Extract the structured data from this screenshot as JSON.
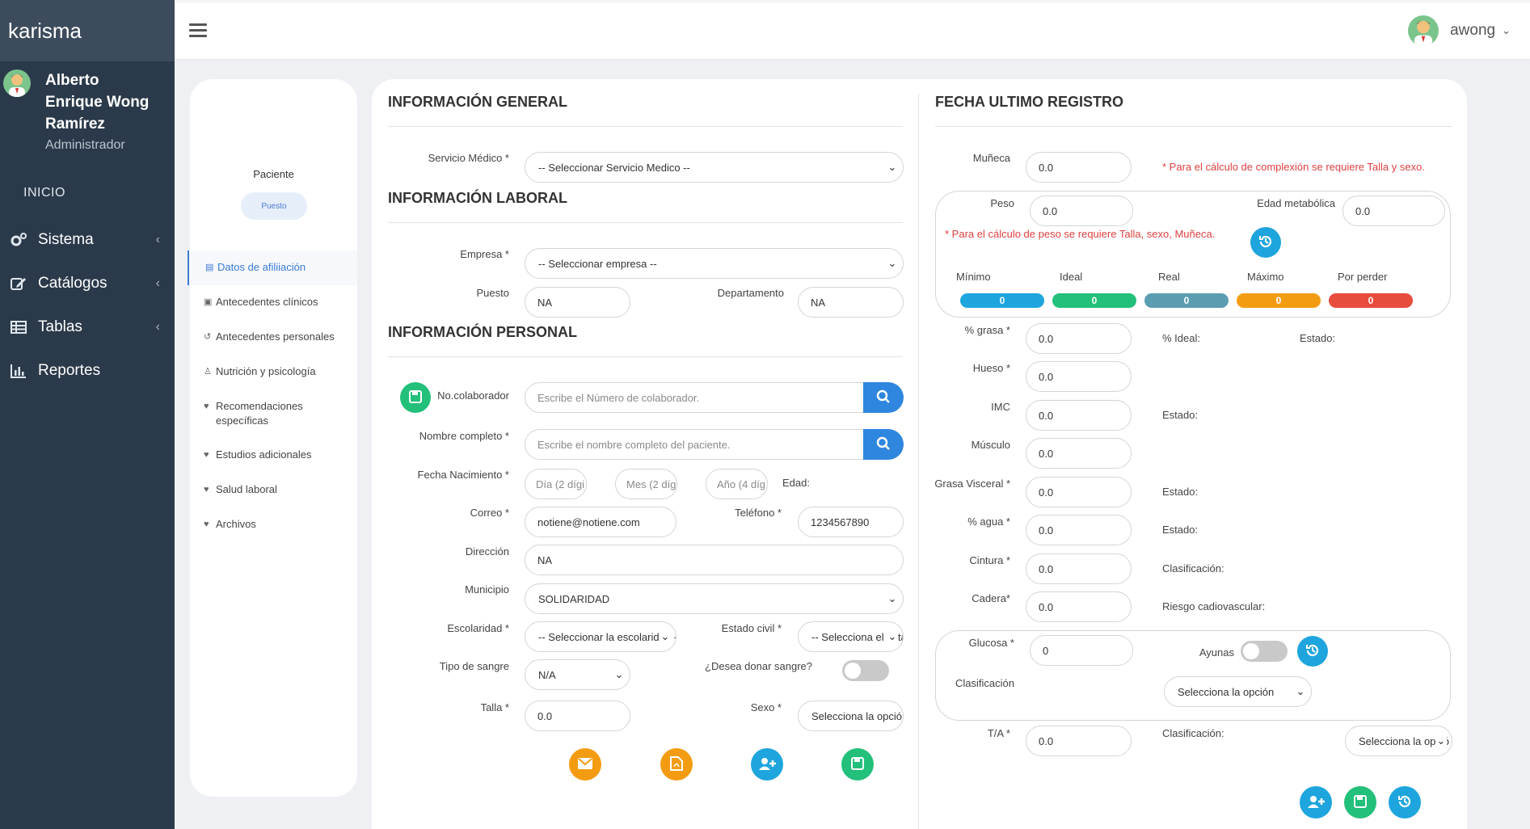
{
  "app": {
    "brand": "karisma"
  },
  "user": {
    "name": "Alberto Enrique Wong Ramírez",
    "role": "Administrador",
    "username": "awong"
  },
  "sidebar": {
    "section_label": "INICIO",
    "items": [
      {
        "label": "Sistema",
        "icon": "cogs-icon"
      },
      {
        "label": "Catálogos",
        "icon": "edit-icon"
      },
      {
        "label": "Tablas",
        "icon": "table-icon"
      },
      {
        "label": "Reportes",
        "icon": "bar-chart-icon"
      }
    ]
  },
  "patient_card": {
    "title": "Paciente",
    "badge": "Puesto",
    "menu": [
      {
        "label": "Datos de afiliiación",
        "icon": "id-card-icon",
        "active": true
      },
      {
        "label": "Antecedentes clínicos",
        "icon": "medkit-icon"
      },
      {
        "label": "Antecedentes personales",
        "icon": "history-icon"
      },
      {
        "label": "Nutrición y psicología",
        "icon": "user-doctor-icon"
      },
      {
        "label": "Recomendaciones específicas",
        "icon": "heartbeat-icon"
      },
      {
        "label": "Estudios adicionales",
        "icon": "heartbeat-icon"
      },
      {
        "label": "Salud laboral",
        "icon": "heartbeat-icon"
      },
      {
        "label": "Archivos",
        "icon": "heartbeat-icon"
      }
    ]
  },
  "general": {
    "title": "INFORMACIÓN GENERAL",
    "servicio_label": "Servicio Médico *",
    "servicio_value": "-- Seleccionar Servicio Medico --"
  },
  "laboral": {
    "title": "INFORMACIÓN LABORAL",
    "empresa_label": "Empresa *",
    "empresa_value": "-- Seleccionar empresa --",
    "puesto_label": "Puesto",
    "puesto_value": "NA",
    "departamento_label": "Departamento",
    "departamento_value": "NA"
  },
  "personal": {
    "title": "INFORMACIÓN PERSONAL",
    "colaborador_label": "No.colaborador",
    "colaborador_placeholder": "Escribe el Número de colaborador.",
    "nombre_label": "Nombre completo *",
    "nombre_placeholder": "Escribe el nombre completo del paciente.",
    "fecha_label": "Fecha Nacimiento *",
    "dia_placeholder": "Día (2 dígi",
    "mes_placeholder": "Mes (2 díg",
    "anio_placeholder": "Año (4 díg",
    "edad_label": "Edad:",
    "correo_label": "Correo *",
    "correo_value": "notiene@notiene.com",
    "telefono_label": "Teléfono *",
    "telefono_value": "1234567890",
    "direccion_label": "Dirección",
    "direccion_value": "NA",
    "municipio_label": "Municipio",
    "municipio_value": "SOLIDARIDAD",
    "escolaridad_label": "Escolaridad *",
    "escolaridad_value": "-- Seleccionar la escolaridad --",
    "estado_civil_label": "Estado civil *",
    "estado_civil_value": "-- Selecciona el esta",
    "sangre_label": "Tipo de sangre",
    "sangre_value": "N/A",
    "donar_label": "¿Desea donar sangre?",
    "talla_label": "Talla *",
    "talla_value": "0.0",
    "sexo_label": "Sexo *",
    "sexo_value": "Selecciona la opció"
  },
  "registro": {
    "title": "FECHA ULTIMO REGISTRO",
    "muneca_label": "Muñeca",
    "muneca_value": "0.0",
    "complexion_note": "* Para el cálculo de complexión se requiere Talla y sexo.",
    "peso_label": "Peso",
    "peso_value": "0.0",
    "edad_metabolica_label": "Edad metabólica",
    "edad_metabolica_value": "0.0",
    "peso_note": "* Para el cálculo de peso se requiere Talla, sexo, Muñeca.",
    "ranges": [
      {
        "label": "Mínimo",
        "value": "0",
        "color": "#1ea5dd"
      },
      {
        "label": "Ideal",
        "value": "0",
        "color": "#22c07a"
      },
      {
        "label": "Real",
        "value": "0",
        "color": "#5b9db0"
      },
      {
        "label": "Máximo",
        "value": "0",
        "color": "#f39c12"
      },
      {
        "label": "Por perder",
        "value": "0",
        "color": "#e74c3c"
      }
    ],
    "grasa_label": "% grasa *",
    "grasa_value": "0.0",
    "grasa_ideal_label": "% Ideal:",
    "grasa_estado_label": "Estado:",
    "hueso_label": "Hueso *",
    "hueso_value": "0.0",
    "imc_label": "IMC",
    "imc_value": "0.0",
    "imc_estado_label": "Estado:",
    "musculo_label": "Músculo",
    "musculo_value": "0.0",
    "visceral_label": "Grasa Visceral *",
    "visceral_value": "0.0",
    "visceral_estado_label": "Estado:",
    "agua_label": "% agua *",
    "agua_value": "0.0",
    "agua_estado_label": "Estado:",
    "cintura_label": "Cintura *",
    "cintura_value": "0.0",
    "cintura_clasif_label": "Clasificación:",
    "cadera_label": "Cadera*",
    "cadera_value": "0.0",
    "cadera_riesgo_label": "Riesgo cadiovascular:",
    "glucosa_label": "Glucosa *",
    "glucosa_value": "0",
    "ayunas_label": "Ayunas",
    "glucosa_clasif_label": "Clasificación",
    "glucosa_clasif_value": "Selecciona la opción",
    "ta_label": "T/A *",
    "ta_value": "0.0",
    "ta_clasif_label": "Clasificación:",
    "ta_clasif_value": "Selecciona la opció"
  }
}
